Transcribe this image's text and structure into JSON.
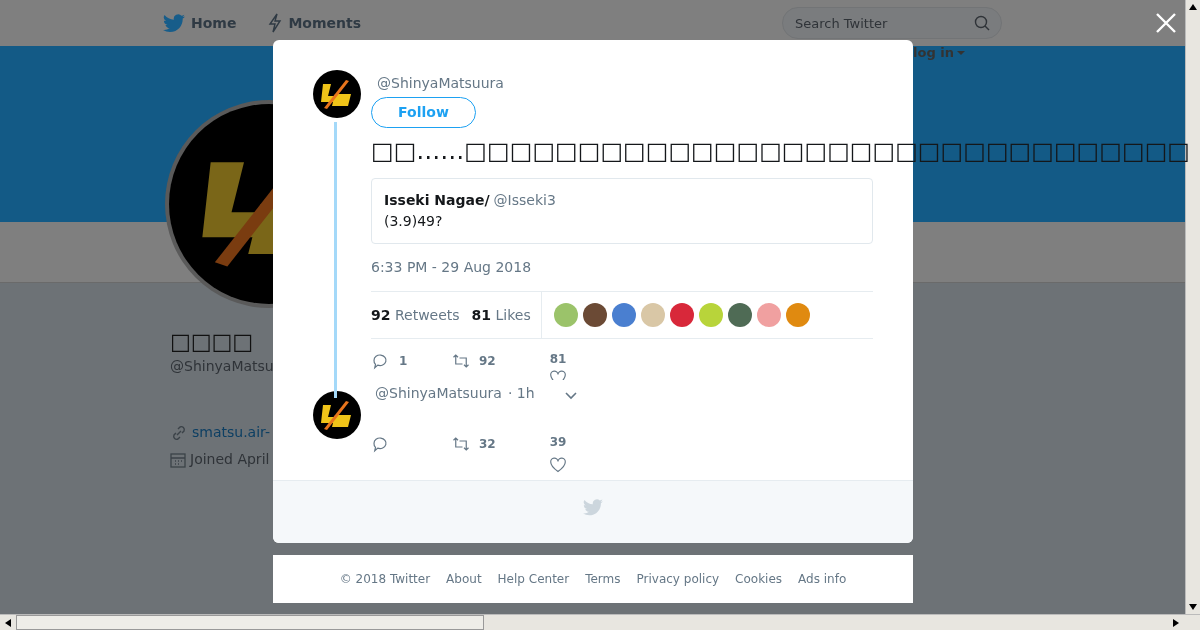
{
  "nav": {
    "items": [
      {
        "label": "Home",
        "kind": "bird"
      },
      {
        "label": "Moments",
        "kind": "bolt"
      }
    ],
    "search": {
      "placeholder": "Search Twitter"
    },
    "login": "log in"
  },
  "profile": {
    "name": "□□□□",
    "handle": "@ShinyaMatsu",
    "link": "smatsu.air-",
    "joined": "Joined April"
  },
  "modal": {
    "tweet": {
      "handle": "@ShinyaMatsuura",
      "follow": "Follow",
      "text": "□□……□□□□□□□□□□□□□□□□□□□□□□□□□□□□□□□□",
      "quote": {
        "name": "Isseki Nagae/",
        "handle": "@Isseki3",
        "text": "(3.9)49?"
      },
      "time": "6:33 PM - 29 Aug 2018",
      "retweets": {
        "count": "92",
        "label": "Retweets"
      },
      "likes": {
        "count": "81",
        "label": "Likes"
      },
      "likers": [
        {
          "color": "#9bc36a"
        },
        {
          "color": "#6b4a35"
        },
        {
          "color": "#4a7fd0"
        },
        {
          "color": "#d9c7a6"
        },
        {
          "color": "#d8283a"
        },
        {
          "color": "#b8d43a"
        },
        {
          "color": "#4f6b55"
        },
        {
          "color": "#f0a0a0"
        },
        {
          "color": "#e08a10"
        }
      ],
      "actions": {
        "replies": "1",
        "retweets": "92",
        "likes": "81"
      }
    },
    "reply": {
      "handle": "@ShinyaMatsuura",
      "time": "· 1h",
      "actions": {
        "retweets": "32",
        "likes": "39"
      }
    }
  },
  "footer": [
    "© 2018 Twitter",
    "About",
    "Help Center",
    "Terms",
    "Privacy policy",
    "Cookies",
    "Ads info"
  ]
}
